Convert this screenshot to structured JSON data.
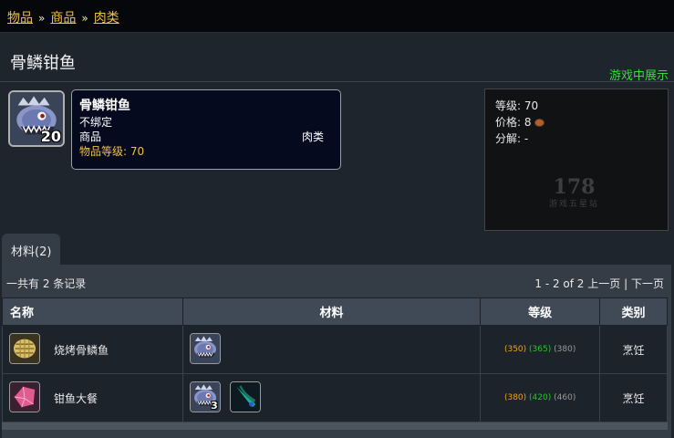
{
  "breadcrumb": [
    "物品",
    "商品",
    "肉类"
  ],
  "breadcrumb_sep": "»",
  "page_title": "骨鳞钳鱼",
  "ingame_link": "游戏中展示",
  "item": {
    "stack": "20",
    "name": "骨鳞钳鱼",
    "bind": "不绑定",
    "class": "商品",
    "subclass": "肉类",
    "level_label": "物品等级:",
    "level_value": "70",
    "icon": "fish-icon"
  },
  "info": {
    "level_label": "等级:",
    "level_value": "70",
    "price_label": "价格:",
    "price_value": "8",
    "disenchant_label": "分解:",
    "disenchant_value": "-",
    "watermark_num": "178",
    "watermark_sub": "游戏五星站"
  },
  "tab": {
    "label": "材料(2)"
  },
  "list": {
    "total_text": "一共有 2 条记录",
    "pager_text": "1 - 2 of 2",
    "prev": "上一页",
    "next": "下一页"
  },
  "table": {
    "headers": [
      "名称",
      "材料",
      "等级",
      "类别"
    ],
    "rows": [
      {
        "name": "烧烤骨鳞鱼",
        "icon": "grilled-fish-icon",
        "materials": [
          {
            "icon": "fish-icon",
            "count": ""
          }
        ],
        "levels": [
          "(350)",
          "(365)",
          "(380)"
        ],
        "type": "烹饪"
      },
      {
        "name": "钳鱼大餐",
        "icon": "pink-crystal-icon",
        "materials": [
          {
            "icon": "fish-icon",
            "count": "3"
          },
          {
            "icon": "spice-icon",
            "count": ""
          }
        ],
        "levels": [
          "(380)",
          "(420)",
          "(460)"
        ],
        "type": "烹饪"
      }
    ]
  },
  "colors": {
    "link": "#f0c040",
    "ingame": "#33dd33",
    "orange": "#f0a020",
    "green": "#22cc22",
    "gray": "#999999"
  }
}
